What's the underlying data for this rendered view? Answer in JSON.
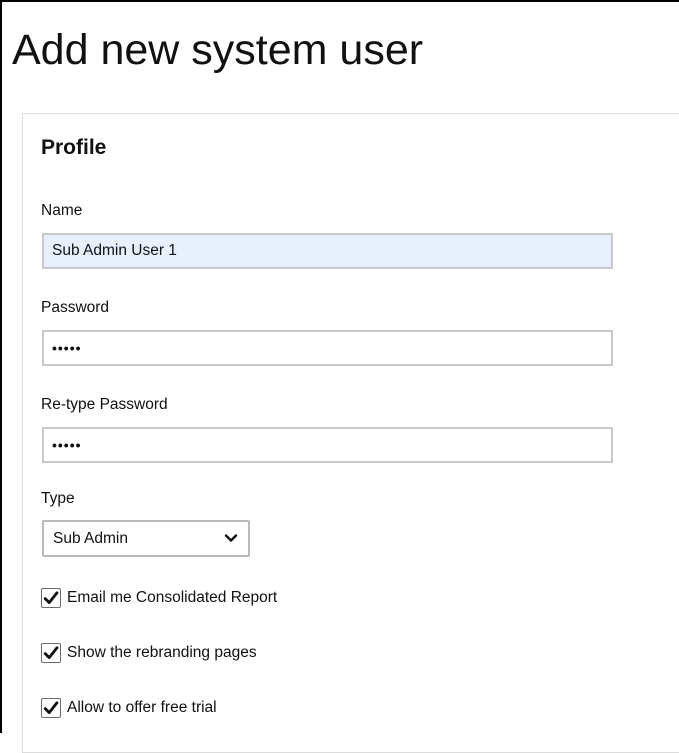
{
  "page": {
    "title": "Add new system user"
  },
  "profile": {
    "section_title": "Profile",
    "name": {
      "label": "Name",
      "value": "Sub Admin User 1"
    },
    "password": {
      "label": "Password",
      "value": "•••••"
    },
    "retype_password": {
      "label": "Re-type Password",
      "value": "•••••"
    },
    "type": {
      "label": "Type",
      "selected": "Sub Admin",
      "icon": "chevron-down-icon"
    },
    "options": [
      {
        "label": "Email me Consolidated Report",
        "checked": true
      },
      {
        "label": "Show the rebranding pages",
        "checked": true
      },
      {
        "label": "Allow to offer free trial",
        "checked": true
      }
    ]
  },
  "colors": {
    "autofill_background": "#e8f0fe",
    "field_border": "#c9c9c9",
    "panel_border": "#dcdcdc",
    "text": "#111111"
  }
}
